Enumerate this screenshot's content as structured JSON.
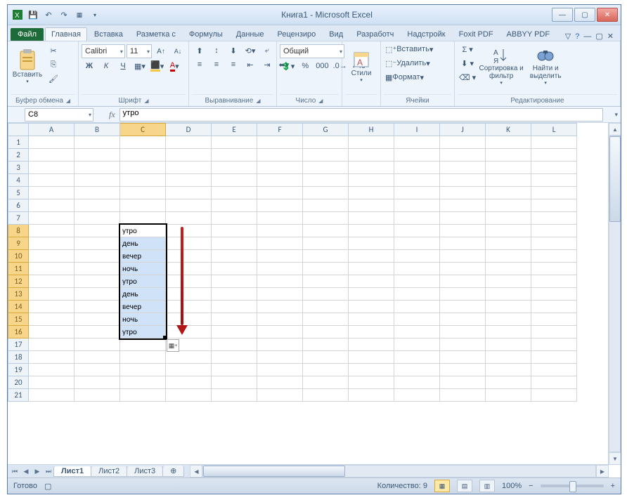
{
  "window": {
    "title": "Книга1 - Microsoft Excel"
  },
  "qat": {
    "save": "save",
    "undo": "undo",
    "redo": "redo"
  },
  "tabs": {
    "file": "Файл",
    "items": [
      "Главная",
      "Вставка",
      "Разметка с",
      "Формулы",
      "Данные",
      "Рецензиро",
      "Вид",
      "Разработч",
      "Надстройк",
      "Foxit PDF",
      "ABBYY PDF"
    ],
    "active": 0
  },
  "ribbon": {
    "clipboard": {
      "paste": "Вставить",
      "label": "Буфер обмена"
    },
    "font": {
      "name": "Calibri",
      "size": "11",
      "label": "Шрифт",
      "bold": "Ж",
      "italic": "К",
      "underline": "Ч",
      "fontcolor": "A"
    },
    "align": {
      "label": "Выравнивание"
    },
    "number": {
      "format": "Общий",
      "label": "Число"
    },
    "styles": {
      "btn": "Стили",
      "label": ""
    },
    "cells": {
      "insert": "Вставить",
      "delete": "Удалить",
      "format": "Формат",
      "label": "Ячейки"
    },
    "editing": {
      "sort": "Сортировка и фильтр",
      "find": "Найти и выделить",
      "label": "Редактирование"
    }
  },
  "formula": {
    "name": "C8",
    "fx": "fx",
    "value": "утро"
  },
  "columns": [
    "A",
    "B",
    "C",
    "D",
    "E",
    "F",
    "G",
    "H",
    "I",
    "J",
    "K",
    "L"
  ],
  "rows": [
    "1",
    "2",
    "3",
    "4",
    "5",
    "6",
    "7",
    "8",
    "9",
    "10",
    "11",
    "12",
    "13",
    "14",
    "15",
    "16",
    "17",
    "18",
    "19",
    "20",
    "21"
  ],
  "cells": {
    "C8": "утро",
    "C9": "день",
    "C10": "вечер",
    "C11": "ночь",
    "C12": "утро",
    "C13": "день",
    "C14": "вечер",
    "C15": "ночь",
    "C16": "утро"
  },
  "selection": {
    "col": "C",
    "rows": [
      8,
      16
    ],
    "active": "C8"
  },
  "sheets": {
    "items": [
      "Лист1",
      "Лист2",
      "Лист3"
    ],
    "active": 0
  },
  "status": {
    "ready": "Готово",
    "count_label": "Количество:",
    "count": "9",
    "zoom": "100%"
  }
}
